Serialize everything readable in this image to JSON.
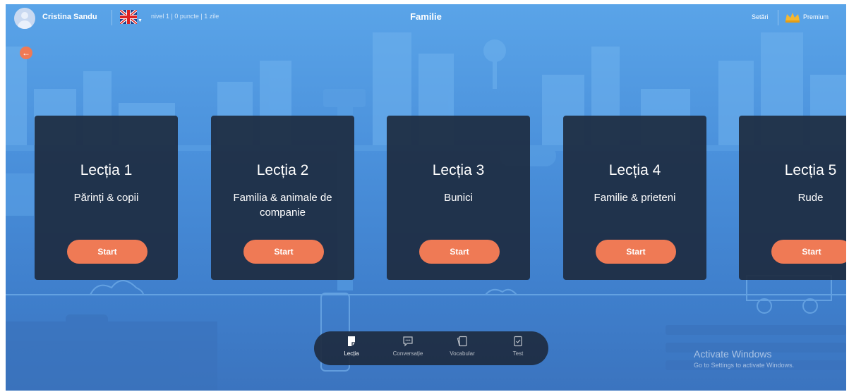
{
  "header": {
    "user_name": "Cristina Sandu",
    "flag_icon": "uk-flag-icon",
    "stats": "nivel 1  |  0 puncte  |  1 zile",
    "page_title": "Familie",
    "settings_label": "Setări",
    "premium_label": "Premium"
  },
  "lessons": [
    {
      "title": "Lecția 1",
      "subtitle": "Părinți & copii",
      "start_label": "Start"
    },
    {
      "title": "Lecția 2",
      "subtitle": "Familia & animale de companie",
      "start_label": "Start"
    },
    {
      "title": "Lecția 3",
      "subtitle": "Bunici",
      "start_label": "Start"
    },
    {
      "title": "Lecția 4",
      "subtitle": "Familie & prieteni",
      "start_label": "Start"
    },
    {
      "title": "Lecția 5",
      "subtitle": "Rude",
      "start_label": "Start"
    }
  ],
  "bottom_nav": {
    "items": [
      {
        "label": "Lecția",
        "icon": "lesson-icon",
        "active": true
      },
      {
        "label": "Conversație",
        "icon": "chat-icon",
        "active": false
      },
      {
        "label": "Vocabular",
        "icon": "cards-icon",
        "active": false
      },
      {
        "label": "Test",
        "icon": "test-icon",
        "active": false
      }
    ]
  },
  "watermark": {
    "title": "Activate Windows",
    "subtitle": "Go to Settings to activate Windows."
  },
  "colors": {
    "accent": "#ef7a55",
    "card_bg": "#1d2b40",
    "sky": "#4a90db"
  }
}
